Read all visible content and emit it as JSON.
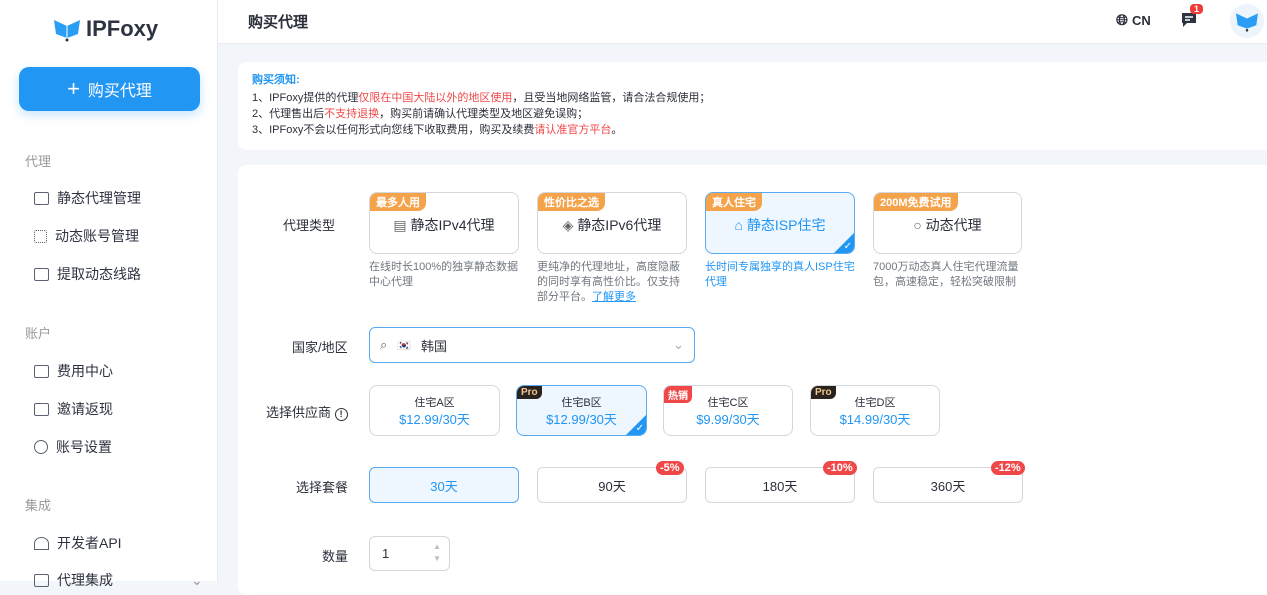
{
  "sidebar": {
    "logo": "IPFoxy",
    "buy_button": "购买代理",
    "sections": [
      {
        "title": "代理",
        "items": [
          "静态代理管理",
          "动态账号管理",
          "提取动态线路"
        ]
      },
      {
        "title": "账户",
        "items": [
          "费用中心",
          "邀请返现",
          "账号设置"
        ]
      },
      {
        "title": "集成",
        "items": [
          "开发者API",
          "代理集成"
        ]
      }
    ]
  },
  "header": {
    "title": "购买代理",
    "lang": "CN",
    "msg_count": "1"
  },
  "notice": {
    "title": "购买须知:",
    "l1a": "1、IPFoxy提供的代理",
    "l1b": "仅限在中国大陆以外的地区使用",
    "l1c": "，且受当地网络监管，请合法合规使用；",
    "l2a": "2、代理售出后",
    "l2b": "不支持退换",
    "l2c": "，购买前请确认代理类型及地区避免误购；",
    "l3a": "3、IPFoxy不会以任何形式向您线下收取费用，购买及续费",
    "l3b": "请认准官方平台",
    "l3c": "。"
  },
  "form": {
    "type_label": "代理类型",
    "country_label": "国家/地区",
    "provider_label": "选择供应商",
    "plan_label": "选择套餐",
    "qty_label": "数量",
    "types": [
      {
        "tag": "最多人用",
        "name": "静态IPv4代理",
        "desc": "在线时长100%的独享静态数据中心代理"
      },
      {
        "tag": "性价比之选",
        "name": "静态IPv6代理",
        "desc": "更纯净的代理地址，高度隐蔽的同时享有高性价比。仅支持部分平台。",
        "link": "了解更多"
      },
      {
        "tag": "真人住宅",
        "name": "静态ISP住宅",
        "desc": "长时间专属独享的真人ISP住宅代理"
      },
      {
        "tag": "200M免费试用",
        "name": "动态代理",
        "desc": "7000万动态真人住宅代理流量包，高速稳定，轻松突破限制"
      }
    ],
    "country": "韩国",
    "providers": [
      {
        "name": "住宅A区",
        "price": "$12.99/30天",
        "tag": ""
      },
      {
        "name": "住宅B区",
        "price": "$12.99/30天",
        "tag": "Pro"
      },
      {
        "name": "住宅C区",
        "price": "$9.99/30天",
        "tag": "热销"
      },
      {
        "name": "住宅D区",
        "price": "$14.99/30天",
        "tag": "Pro"
      }
    ],
    "plans": [
      {
        "label": "30天"
      },
      {
        "label": "90天",
        "disc": "-5%"
      },
      {
        "label": "180天",
        "disc": "-10%"
      },
      {
        "label": "360天",
        "disc": "-12%"
      }
    ],
    "qty": "1"
  },
  "colors": {
    "accent": "#2196f3",
    "red": "#f04848",
    "tag": "#f5a34b"
  }
}
